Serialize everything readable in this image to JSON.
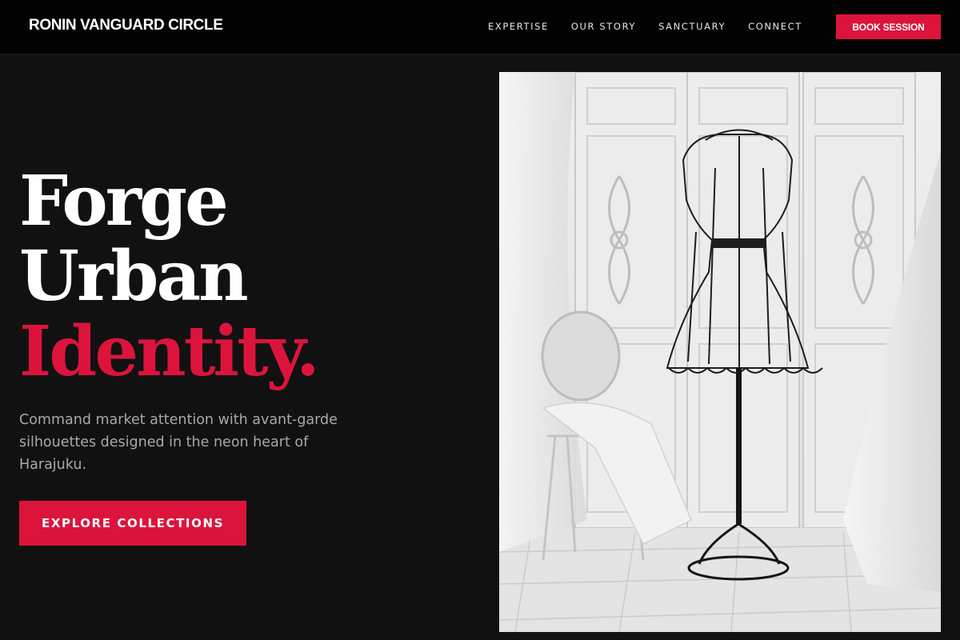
{
  "brand": {
    "name": "RONIN VANGUARD CIRCLE"
  },
  "nav": {
    "links": [
      "EXPERTISE",
      "OUR STORY",
      "SANCTUARY",
      "CONNECT"
    ],
    "cta_label": "BOOK SESSION"
  },
  "hero": {
    "title_lines": [
      "Forge",
      "Urban",
      "Identity."
    ],
    "subtitle": "Command market attention with avant-garde silhouettes designed in the neon heart of Harajuku.",
    "cta_label": "EXPLORE COLLECTIONS",
    "image_subject": "dress-form-mannequin-photo"
  },
  "colors": {
    "accent": "#dc143c",
    "background": "#111112",
    "navbar": "#030303",
    "text": "#ffffff",
    "muted_text": "#a8a8b0"
  }
}
